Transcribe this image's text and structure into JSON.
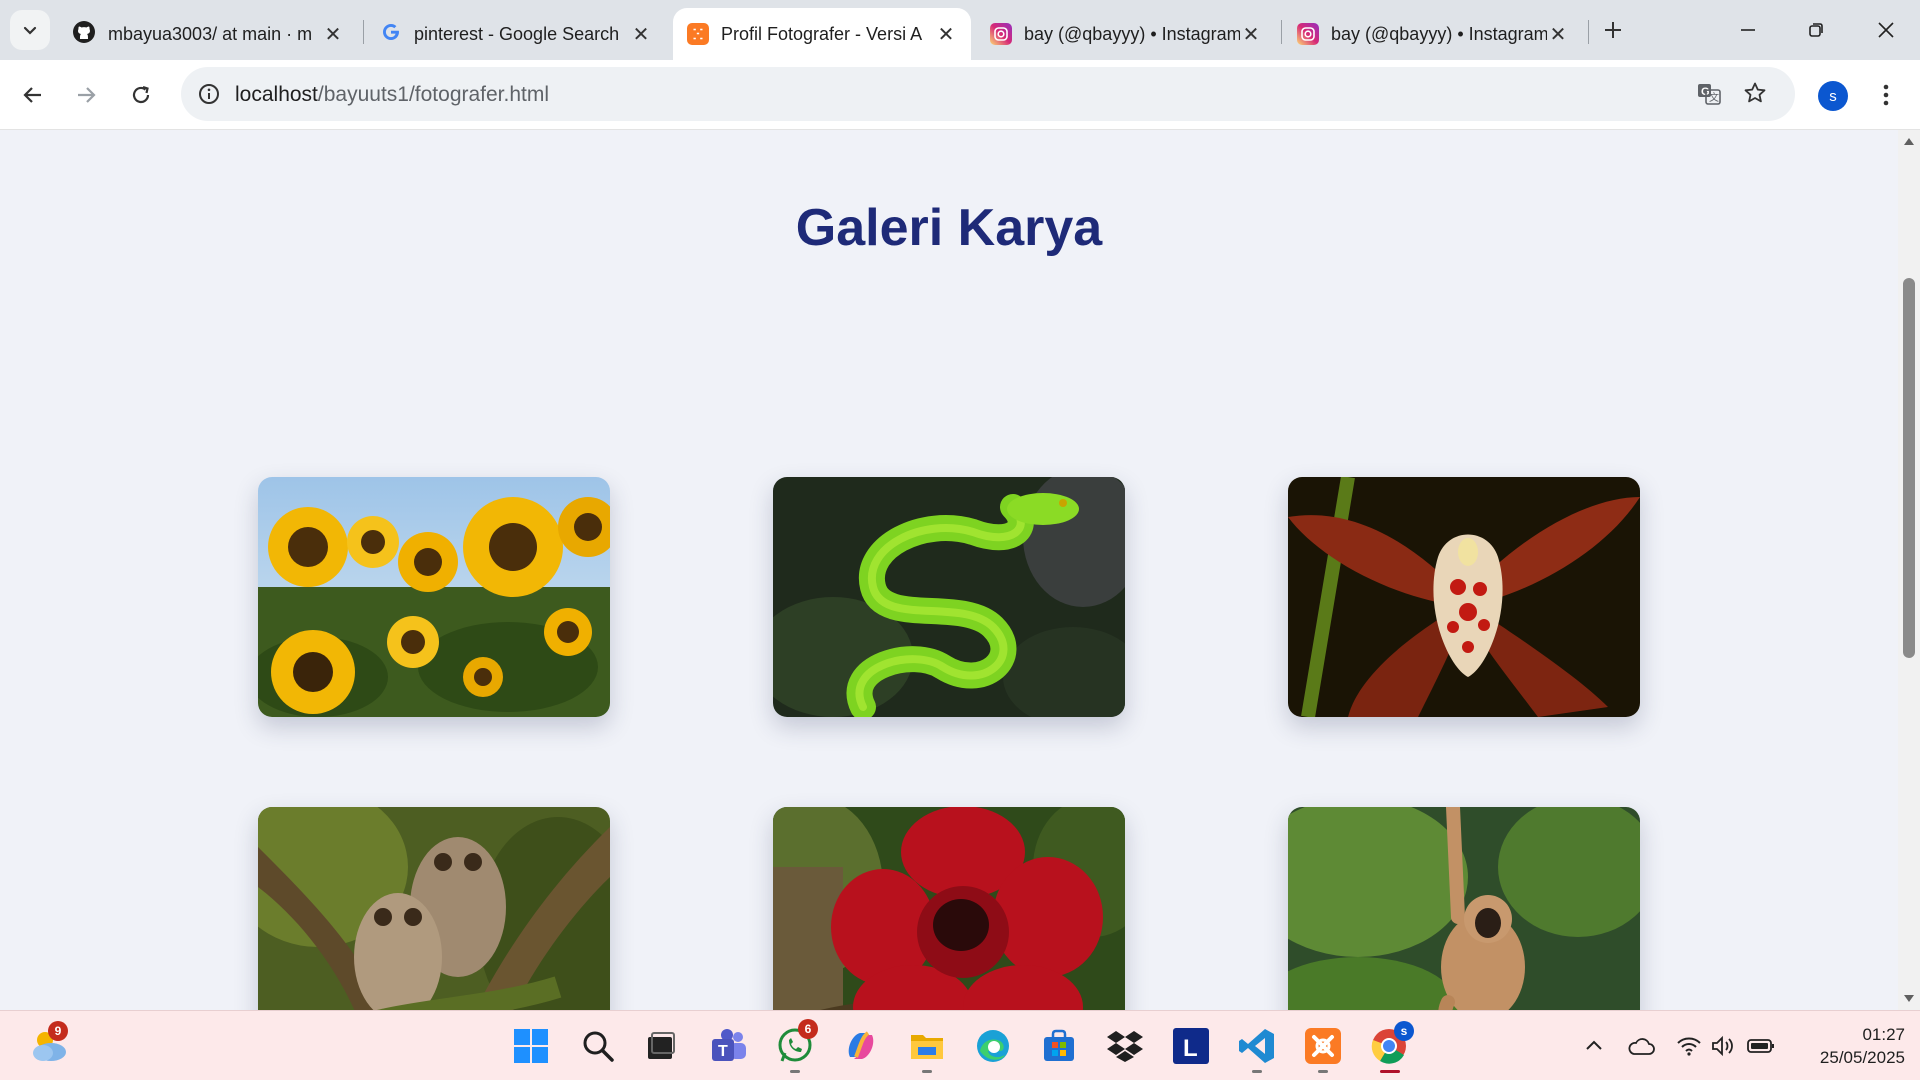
{
  "browser": {
    "tabs": [
      {
        "title": "mbayua3003/ at main · m",
        "icon": "github-icon"
      },
      {
        "title": "pinterest - Google Search",
        "icon": "google-icon"
      },
      {
        "title": "Profil Fotografer - Versi A",
        "icon": "xampp-icon",
        "active": true
      },
      {
        "title": "bay (@qbayyy) • Instagram",
        "icon": "instagram-icon"
      },
      {
        "title": "bay (@qbayyy) • Instagram",
        "icon": "instagram-icon"
      }
    ],
    "url_host": "localhost",
    "url_path": "/bayuuts1/fotografer.html",
    "profile_initial": "s"
  },
  "page": {
    "title": "Galeri Karya",
    "photos": [
      {
        "subject": "sunflowers"
      },
      {
        "subject": "green pit viper snake"
      },
      {
        "subject": "orchid flower"
      },
      {
        "subject": "barred owls"
      },
      {
        "subject": "rafflesia flower"
      },
      {
        "subject": "gibbon"
      }
    ]
  },
  "taskbar": {
    "weather_badge": "9",
    "whatsapp_badge": "6",
    "chrome_badge": "s",
    "time": "01:27",
    "date": "25/05/2025"
  },
  "colors": {
    "title": "#1e2a78",
    "page_bg": "#f0f2f8",
    "taskbar_bg": "#fde9ea",
    "tabbar_bg": "#dfe3e8"
  }
}
